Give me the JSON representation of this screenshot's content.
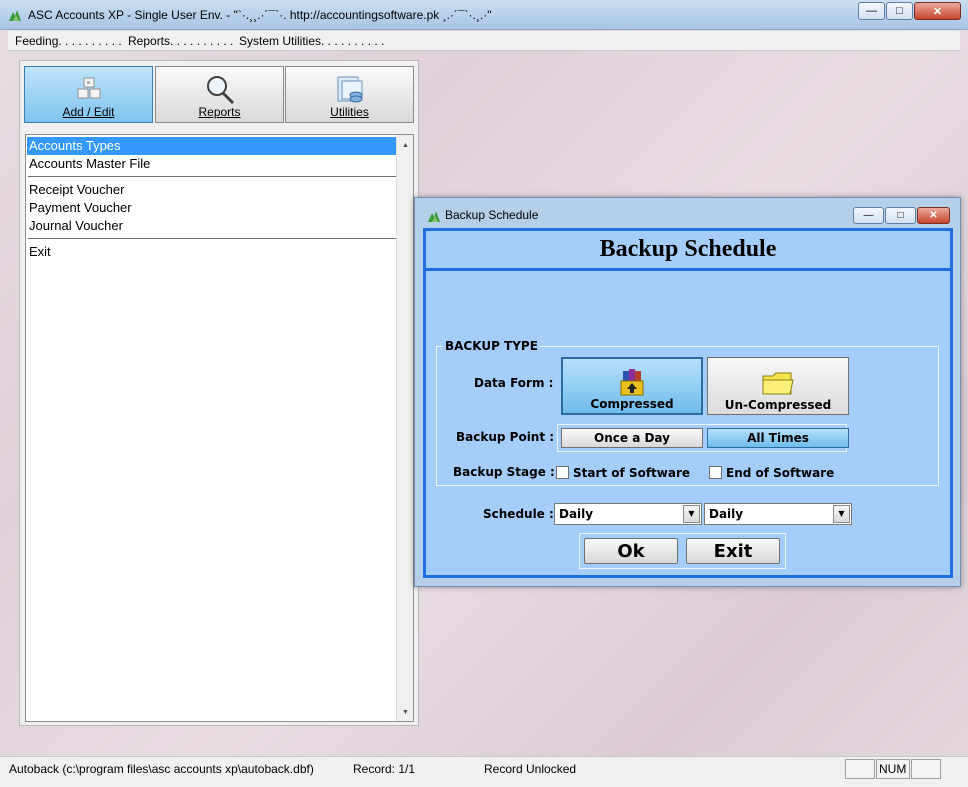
{
  "window": {
    "title": "ASC Accounts XP - Single User Env.  - \"`·.¸¸.·´¯`·. http://accountingsoftware.pk ¸.·´¯`·.¸.·\"",
    "min": "—",
    "max": "□",
    "close": "✕"
  },
  "menu": [
    "Feeding. . . . . . . . . .",
    "Reports. . . . . . . . . .",
    "System Utilities. . . . . . . . . ."
  ],
  "tabs": [
    {
      "label": "Add / Edit",
      "icon": "add-edit-icon"
    },
    {
      "label": "Reports",
      "icon": "magnifier-icon"
    },
    {
      "label": "Utilities",
      "icon": "utilities-icon"
    }
  ],
  "list": {
    "group1": [
      "Accounts Types",
      "Accounts Master File"
    ],
    "group2": [
      "Receipt Voucher",
      "Payment Voucher",
      "Journal Voucher"
    ],
    "group3": [
      "Exit"
    ],
    "selected": "Accounts Types"
  },
  "status": {
    "path": "Autoback (c:\\program files\\asc accounts xp\\autoback.dbf)",
    "record": "Record: 1/1",
    "lock": "Record Unlocked",
    "num": "NUM"
  },
  "dialog": {
    "title": "Backup Schedule",
    "header": "Backup Schedule",
    "group_label": "BACKUP TYPE",
    "data_form_label": "Data Form :",
    "compressed": "Compressed",
    "uncompressed": "Un-Compressed",
    "backup_point_label": "Backup Point :",
    "once_a_day": "Once a Day",
    "all_times": "All Times",
    "backup_stage_label": "Backup Stage :",
    "start_of_software": "Start of Software",
    "end_of_software": "End of Software",
    "schedule_label": "Schedule :",
    "schedule_value_1": "Daily",
    "schedule_value_2": "Daily",
    "ok": "Ok",
    "exit": "Exit"
  },
  "colors": {
    "accent": "#1f6fe0",
    "selection": "#3399ff",
    "dialog_bg": "#a4cdfb"
  }
}
